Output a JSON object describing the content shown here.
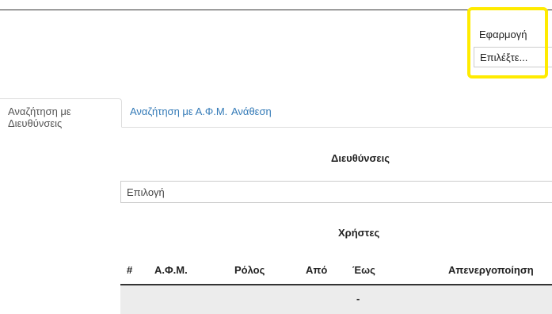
{
  "app_selector": {
    "label": "Εφαρμογή",
    "placeholder": "Επιλέξτε..."
  },
  "tabs": [
    {
      "label": "Αναζήτηση με Διευθύνσεις",
      "active": true
    },
    {
      "label": "Αναζήτηση με Α.Φ.Μ.",
      "active": false
    },
    {
      "label": "Ανάθεση",
      "active": false
    }
  ],
  "addresses": {
    "heading": "Διευθύνσεις",
    "select_value": "Επιλογή"
  },
  "users": {
    "heading": "Χρήστες",
    "columns": [
      "#",
      "Α.Φ.Μ.",
      "Ρόλος",
      "Από",
      "Έως",
      "Απενεργοποίηση"
    ],
    "rows": [
      {
        "placeholder": "-"
      }
    ]
  },
  "colors": {
    "highlight": "#ffeb00",
    "link": "#337ab7"
  }
}
